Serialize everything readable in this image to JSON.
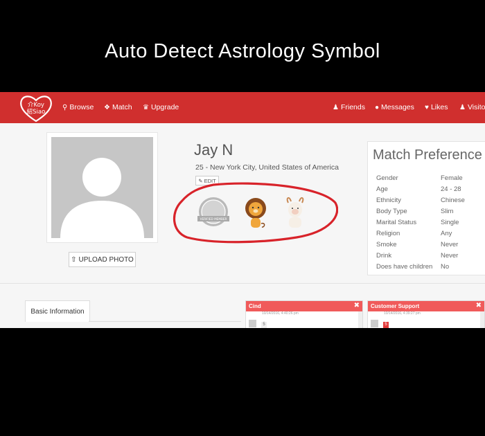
{
  "caption": "Auto Detect Astrology Symbol",
  "brand": {
    "logo_text_top": "介Koy",
    "logo_text_bottom": "紹Siao",
    "primary_color": "#d02f2e"
  },
  "nav": {
    "left": [
      {
        "icon": "search-icon",
        "label": "Browse"
      },
      {
        "icon": "puzzle-icon",
        "label": "Match"
      },
      {
        "icon": "trophy-icon",
        "label": "Upgrade"
      }
    ],
    "right": [
      {
        "icon": "users-icon",
        "label": "Friends"
      },
      {
        "icon": "chat-icon",
        "label": "Messages"
      },
      {
        "icon": "heart-icon",
        "label": "Likes"
      },
      {
        "icon": "visitor-icon",
        "label": "Visitor"
      }
    ]
  },
  "profile": {
    "name": "Jay N",
    "location": "25 - New York City, United States of America",
    "edit_label": "EDIT",
    "upload_label": "UPLOAD PHOTO",
    "badges": [
      {
        "icon": "verified-member-badge-icon",
        "label": "VERIFIED MEMBER"
      },
      {
        "icon": "lion-leo-icon"
      },
      {
        "icon": "goat-icon"
      }
    ]
  },
  "preference": {
    "title": "Match Preference",
    "rows": [
      {
        "k": "Gender",
        "v": "Female"
      },
      {
        "k": "Age",
        "v": "24 - 28"
      },
      {
        "k": "Ethnicity",
        "v": "Chinese"
      },
      {
        "k": "Body Type",
        "v": "Slim"
      },
      {
        "k": "Marital Status",
        "v": "Single"
      },
      {
        "k": "Religion",
        "v": "Any"
      },
      {
        "k": "Smoke",
        "v": "Never"
      },
      {
        "k": "Drink",
        "v": "Never"
      },
      {
        "k": "Does have children",
        "v": "No"
      }
    ]
  },
  "tabs": {
    "basic": "Basic Information"
  },
  "chats": [
    {
      "name": "Cind",
      "time": "10/14/2016, 4:40:26 pm",
      "badge": "5"
    },
    {
      "name": "Customer Support",
      "time": "10/14/2016, 4:39:27 pm",
      "badge": "5"
    }
  ]
}
